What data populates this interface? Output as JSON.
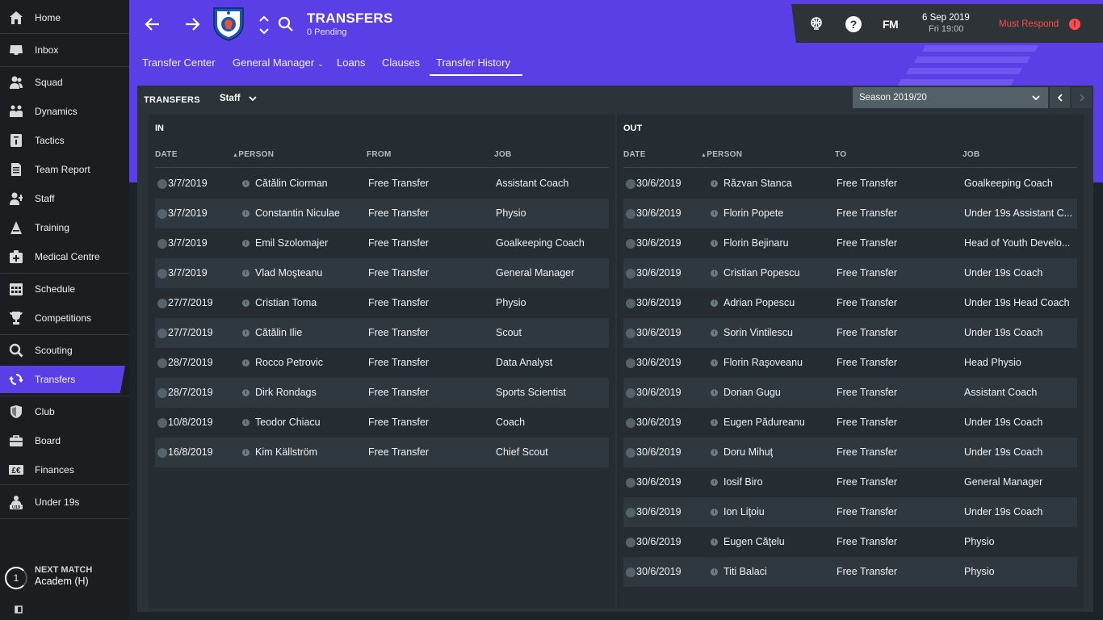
{
  "sidebar": {
    "items": [
      {
        "label": "Home",
        "icon": "home-icon"
      },
      {
        "label": "Inbox",
        "icon": "inbox-icon"
      },
      {
        "label": "Squad",
        "icon": "squad-icon"
      },
      {
        "label": "Dynamics",
        "icon": "dynamics-icon"
      },
      {
        "label": "Tactics",
        "icon": "tactics-icon"
      },
      {
        "label": "Team Report",
        "icon": "report-icon"
      },
      {
        "label": "Staff",
        "icon": "staff-icon"
      },
      {
        "label": "Training",
        "icon": "training-icon"
      },
      {
        "label": "Medical Centre",
        "icon": "medical-icon"
      },
      {
        "label": "Schedule",
        "icon": "calendar-icon"
      },
      {
        "label": "Competitions",
        "icon": "trophy-icon"
      },
      {
        "label": "Scouting",
        "icon": "search-icon"
      },
      {
        "label": "Transfers",
        "icon": "transfers-icon"
      },
      {
        "label": "Club",
        "icon": "shield-icon"
      },
      {
        "label": "Board",
        "icon": "briefcase-icon"
      },
      {
        "label": "Finances",
        "icon": "money-icon"
      },
      {
        "label": "Under 19s",
        "icon": "u19-icon"
      }
    ],
    "active": "Transfers",
    "next_match": {
      "title": "NEXT MATCH",
      "team": "Academ (H)",
      "days": "1"
    }
  },
  "header": {
    "title": "TRANSFERS",
    "subtitle": "0 Pending",
    "tabs": [
      {
        "label": "Transfer Center"
      },
      {
        "label": "General Manager"
      },
      {
        "label": "Loans"
      },
      {
        "label": "Clauses"
      },
      {
        "label": "Transfer History"
      }
    ],
    "active_tab": "Transfer History",
    "accent_color": "#5b3fe6"
  },
  "top_right": {
    "help": "?",
    "brand": "FM",
    "date": "6 Sep 2019",
    "time": "Fri 19:00",
    "respond": "Must Respond",
    "alert": "!"
  },
  "panel": {
    "title": "TRANSFERS",
    "filter": "Staff",
    "season": "Season 2019/20"
  },
  "transfers_in": {
    "title": "IN",
    "headers": {
      "date": "DATE",
      "person": "PERSON",
      "from": "FROM",
      "job": "JOB"
    },
    "rows": [
      {
        "date": "3/7/2019",
        "person": "Cătălin Ciorman",
        "from": "Free Transfer",
        "job": "Assistant Coach"
      },
      {
        "date": "3/7/2019",
        "person": "Constantin Niculae",
        "from": "Free Transfer",
        "job": "Physio"
      },
      {
        "date": "3/7/2019",
        "person": "Emil Szolomajer",
        "from": "Free Transfer",
        "job": "Goalkeeping Coach"
      },
      {
        "date": "3/7/2019",
        "person": "Vlad Moşteanu",
        "from": "Free Transfer",
        "job": "General Manager"
      },
      {
        "date": "27/7/2019",
        "person": "Cristian Toma",
        "from": "Free Transfer",
        "job": "Physio"
      },
      {
        "date": "27/7/2019",
        "person": "Cătălin Ilie",
        "from": "Free Transfer",
        "job": "Scout"
      },
      {
        "date": "28/7/2019",
        "person": "Rocco Petrovic",
        "from": "Free Transfer",
        "job": "Data Analyst"
      },
      {
        "date": "28/7/2019",
        "person": "Dirk Rondags",
        "from": "Free Transfer",
        "job": "Sports Scientist"
      },
      {
        "date": "10/8/2019",
        "person": "Teodor Chiacu",
        "from": "Free Transfer",
        "job": "Coach"
      },
      {
        "date": "16/8/2019",
        "person": "Kim Källström",
        "from": "Free Transfer",
        "job": "Chief Scout"
      }
    ]
  },
  "transfers_out": {
    "title": "OUT",
    "headers": {
      "date": "DATE",
      "person": "PERSON",
      "to": "TO",
      "job": "JOB"
    },
    "rows": [
      {
        "date": "30/6/2019",
        "person": "Răzvan Stanca",
        "to": "Free Transfer",
        "job": "Goalkeeping Coach"
      },
      {
        "date": "30/6/2019",
        "person": "Florin Popete",
        "to": "Free Transfer",
        "job": "Under 19s Assistant C..."
      },
      {
        "date": "30/6/2019",
        "person": "Florin Bejinaru",
        "to": "Free Transfer",
        "job": "Head of Youth Develo..."
      },
      {
        "date": "30/6/2019",
        "person": "Cristian Popescu",
        "to": "Free Transfer",
        "job": "Under 19s Coach"
      },
      {
        "date": "30/6/2019",
        "person": "Adrian Popescu",
        "to": "Free Transfer",
        "job": "Under 19s Head Coach"
      },
      {
        "date": "30/6/2019",
        "person": "Sorin Vintilescu",
        "to": "Free Transfer",
        "job": "Under 19s Coach"
      },
      {
        "date": "30/6/2019",
        "person": "Florin Raşoveanu",
        "to": "Free Transfer",
        "job": "Head Physio"
      },
      {
        "date": "30/6/2019",
        "person": "Dorian Gugu",
        "to": "Free Transfer",
        "job": "Assistant Coach"
      },
      {
        "date": "30/6/2019",
        "person": "Eugen Pădureanu",
        "to": "Free Transfer",
        "job": "Under 19s Coach"
      },
      {
        "date": "30/6/2019",
        "person": "Doru Mihuţ",
        "to": "Free Transfer",
        "job": "Under 19s Coach"
      },
      {
        "date": "30/6/2019",
        "person": "Iosif Biro",
        "to": "Free Transfer",
        "job": "General Manager"
      },
      {
        "date": "30/6/2019",
        "person": "Ion Liţoiu",
        "to": "Free Transfer",
        "job": "Under 19s Coach"
      },
      {
        "date": "30/6/2019",
        "person": "Eugen Căţelu",
        "to": "Free Transfer",
        "job": "Physio"
      },
      {
        "date": "30/6/2019",
        "person": "Titi Balaci",
        "to": "Free Transfer",
        "job": "Physio"
      }
    ]
  }
}
